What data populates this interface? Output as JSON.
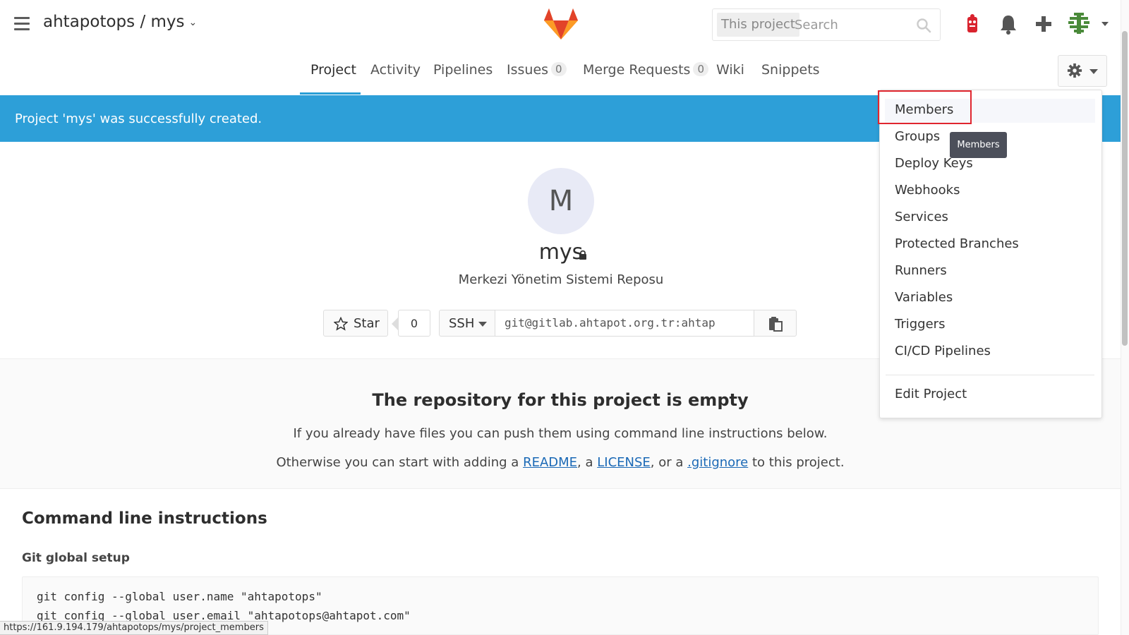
{
  "header": {
    "breadcrumb": "ahtapotops / mys",
    "search_scope": "This project",
    "search_placeholder": "Search"
  },
  "nav": {
    "tabs": [
      {
        "label": "Project",
        "active": true
      },
      {
        "label": "Activity"
      },
      {
        "label": "Pipelines"
      },
      {
        "label": "Issues",
        "count": "0"
      },
      {
        "label": "Merge Requests",
        "count": "0"
      },
      {
        "label": "Wiki"
      },
      {
        "label": "Snippets"
      }
    ]
  },
  "flash": {
    "message": "Project 'mys' was successfully created."
  },
  "project": {
    "avatar_letter": "M",
    "name": "mys",
    "description": "Merkezi Yönetim Sistemi Reposu",
    "star_label": "Star",
    "star_count": "0",
    "protocol": "SSH",
    "clone_url": "git@gitlab.ahtapot.org.tr:ahtap"
  },
  "empty_repo": {
    "title": "The repository for this project is empty",
    "line1": "If you already have files you can push them using command line instructions below.",
    "line2_prefix": "Otherwise you can start with adding a ",
    "readme": "README",
    "sep1": ", a ",
    "license": "LICENSE",
    "sep2": ", or a ",
    "gitignore": ".gitignore",
    "line2_suffix": " to this project."
  },
  "cli": {
    "title": "Command line instructions",
    "git_setup": "Git global setup",
    "code": [
      "git config --global user.name \"ahtapotops\"",
      "git config --global user.email \"ahtapotops@ahtapot.com\""
    ]
  },
  "settings_menu": {
    "items": [
      "Members",
      "Groups",
      "Deploy Keys",
      "Webhooks",
      "Services",
      "Protected Branches",
      "Runners",
      "Variables",
      "Triggers",
      "CI/CD Pipelines"
    ],
    "edit": "Edit Project",
    "tooltip": "Members"
  },
  "status_url": "https://161.9.194.179/ahtapotops/mys/project_members",
  "colors": {
    "accent": "#2d9fd8",
    "tanuki_orange": "#fc6d26",
    "tanuki_red": "#e24329",
    "focus_border": "#e0262f",
    "link": "#1b69b6"
  },
  "icons": {
    "menu": "hamburger-icon",
    "logo": "gitlab-tanuki-icon",
    "search": "search-icon",
    "todo": "todo-icon",
    "notifications": "bell-icon",
    "new": "plus-icon",
    "user": "user-avatar-icon",
    "settings": "gear-icon",
    "lock": "lock-icon",
    "star": "star-icon",
    "copy": "clipboard-icon"
  }
}
